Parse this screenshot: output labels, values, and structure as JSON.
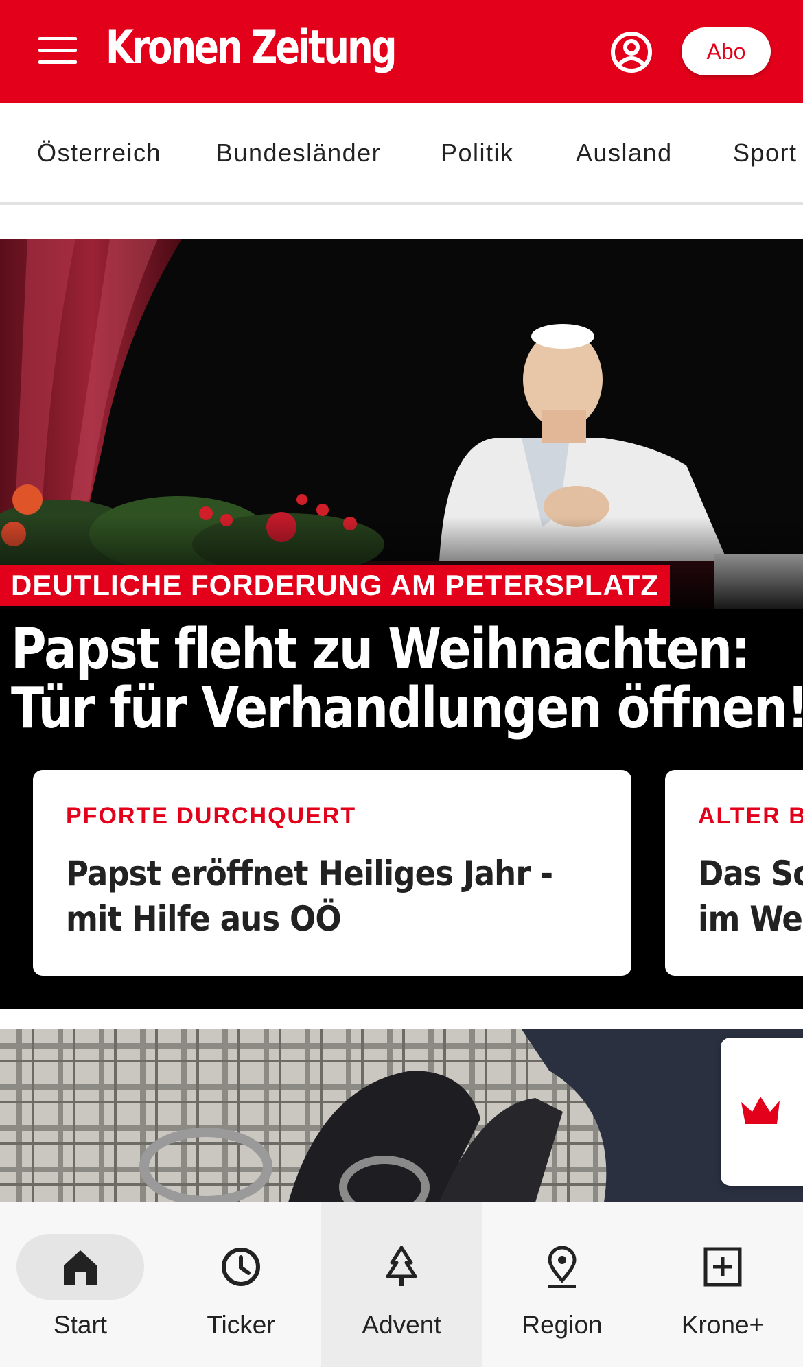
{
  "header": {
    "logo_text": "Kronen Zeitung",
    "abo_label": "Abo",
    "brand_color": "#e2001a"
  },
  "nav": {
    "items": [
      "Österreich",
      "Bundesländer",
      "Politik",
      "Ausland",
      "Sport"
    ]
  },
  "hero": {
    "kicker": "DEUTLICHE FORDERUNG AM PETERSPLATZ",
    "title_line1": "Papst fleht zu Weihnachten:",
    "title_line2": "Tür für Verhandlungen öffnen!"
  },
  "cards": [
    {
      "kicker": "PFORTE DURCHQUERT",
      "title": "Papst eröffnet Heiliges Jahr -\nmit Hilfe aus OÖ"
    },
    {
      "kicker": "ALTER BRAUCH",
      "title": "Das Scheitern\nim Weihnachtsfest"
    }
  ],
  "bottom_nav": {
    "tabs": [
      {
        "label": "Start",
        "icon": "home-icon"
      },
      {
        "label": "Ticker",
        "icon": "clock-icon"
      },
      {
        "label": "Advent",
        "icon": "tree-icon"
      },
      {
        "label": "Region",
        "icon": "location-pin-icon"
      },
      {
        "label": "Krone+",
        "icon": "plus-box-icon"
      }
    ]
  }
}
